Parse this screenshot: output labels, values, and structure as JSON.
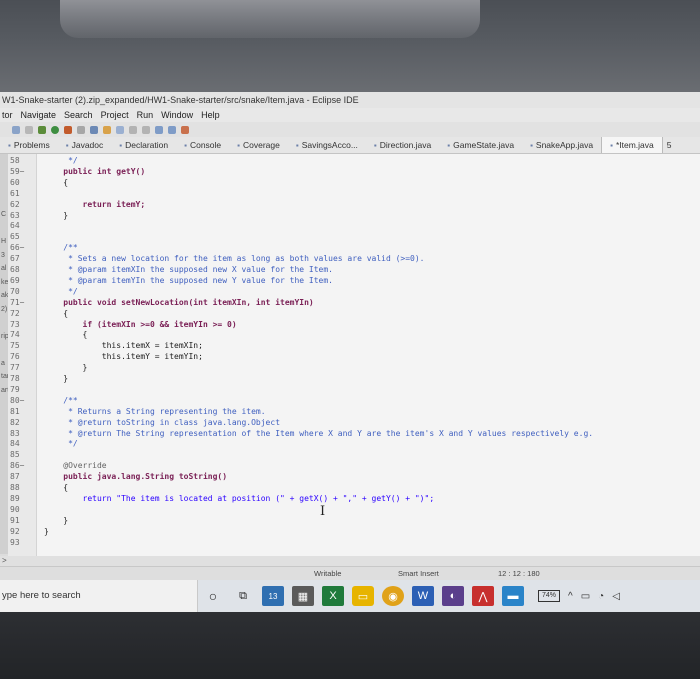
{
  "window": {
    "title": "W1-Snake-starter (2).zip_expanded/HW1-Snake-starter/src/snake/Item.java - Eclipse IDE"
  },
  "menu": [
    "tor",
    "Navigate",
    "Search",
    "Project",
    "Run",
    "Window",
    "Help"
  ],
  "tabs": [
    {
      "label": "Problems",
      "icon": "problems-icon"
    },
    {
      "label": "Javadoc",
      "icon": "javadoc-icon"
    },
    {
      "label": "Declaration",
      "icon": "declaration-icon"
    },
    {
      "label": "Console",
      "icon": "console-icon"
    },
    {
      "label": "Coverage",
      "icon": "coverage-icon"
    },
    {
      "label": "SavingsAcco...",
      "icon": "java-file-icon"
    },
    {
      "label": "Direction.java",
      "icon": "java-file-icon"
    },
    {
      "label": "GameState.java",
      "icon": "java-file-icon"
    },
    {
      "label": "SnakeApp.java",
      "icon": "java-file-icon"
    },
    {
      "label": "*Item.java",
      "icon": "java-file-icon",
      "active": true
    }
  ],
  "tab_overflow": "5",
  "left_strip": [
    "",
    "",
    "",
    "",
    "C",
    "",
    "H",
    "3",
    "al",
    "ke",
    "ake",
    "2)",
    "",
    "rip",
    "",
    "a",
    "tar",
    "arte"
  ],
  "code": {
    "lines": [
      {
        "num": "58",
        "text": "     */"
      },
      {
        "num": "59−",
        "text": "    public int getY()"
      },
      {
        "num": "60",
        "text": "    {"
      },
      {
        "num": "61",
        "text": ""
      },
      {
        "num": "62",
        "text": "        return itemY;"
      },
      {
        "num": "63",
        "text": "    }"
      },
      {
        "num": "64",
        "text": ""
      },
      {
        "num": "65",
        "text": ""
      },
      {
        "num": "66−",
        "text": "    /**"
      },
      {
        "num": "67",
        "text": "     * Sets a new location for the item as long as both values are valid (>=0)."
      },
      {
        "num": "68",
        "text": "     * @param itemXIn the supposed new X value for the Item."
      },
      {
        "num": "69",
        "text": "     * @param itemYIn the supposed new Y value for the Item."
      },
      {
        "num": "70",
        "text": "     */"
      },
      {
        "num": "71−",
        "text": "    public void setNewLocation(int itemXIn, int itemYIn)"
      },
      {
        "num": "72",
        "text": "    {"
      },
      {
        "num": "73",
        "text": "        if (itemXIn >=0 && itemYIn >= 0)"
      },
      {
        "num": "74",
        "text": "        {"
      },
      {
        "num": "75",
        "text": "            this.itemX = itemXIn;"
      },
      {
        "num": "76",
        "text": "            this.itemY = itemYIn;"
      },
      {
        "num": "77",
        "text": "        }"
      },
      {
        "num": "78",
        "text": "    }"
      },
      {
        "num": "79",
        "text": ""
      },
      {
        "num": "80−",
        "text": "    /**"
      },
      {
        "num": "81",
        "text": "     * Returns a String representing the item."
      },
      {
        "num": "82",
        "text": "     * @return toString in class java.lang.Object"
      },
      {
        "num": "83",
        "text": "     * @return The String representation of the Item where X and Y are the item's X and Y values respectively e.g."
      },
      {
        "num": "84",
        "text": "     */"
      },
      {
        "num": "85",
        "text": ""
      },
      {
        "num": "86−",
        "text": "    @Override"
      },
      {
        "num": "87",
        "text": "    public java.lang.String toString()"
      },
      {
        "num": "88",
        "text": "    {"
      },
      {
        "num": "89",
        "text": "        return \"The item is located at position (\" + getX() + \",\" + getY() + \")\";"
      },
      {
        "num": "90",
        "text": ""
      },
      {
        "num": "91",
        "text": "    }"
      },
      {
        "num": "92",
        "text": "}"
      },
      {
        "num": "93",
        "text": ""
      }
    ]
  },
  "status": {
    "writable": "Writable",
    "insert_mode": "Smart Insert",
    "position": "12 : 12 : 180",
    "scroll_marker": ">"
  },
  "taskbar": {
    "search_placeholder": "ype here to search",
    "mail_badge": "13",
    "battery": "74%"
  },
  "colors": {
    "keyword": "#7a1f55",
    "javadoc": "#3f5fbf",
    "string": "#2a00ff",
    "annotation": "#646464"
  }
}
